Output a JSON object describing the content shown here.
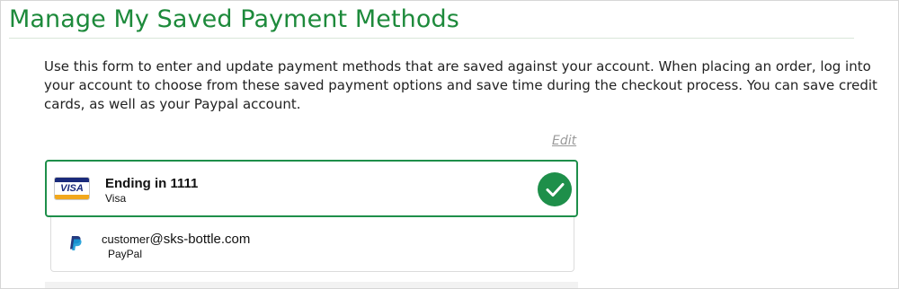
{
  "page": {
    "title": "Manage My Saved Payment Methods",
    "intro": "Use this form to enter and update payment methods that are saved against your account. When placing an order, log into your account to choose from these saved payment options and save time during the checkout process. You can save credit cards, as well as your Paypal account.",
    "edit_label": "Edit"
  },
  "payment_methods": [
    {
      "icon": "visa-card-icon",
      "logo_text": "VISA",
      "title": "Ending in 1111",
      "subtitle": "Visa",
      "selected": true
    },
    {
      "icon": "paypal-icon",
      "title_user": "customer",
      "title_domain": "@sks-bottle.com",
      "subtitle": "PayPal",
      "selected": false
    }
  ],
  "colors": {
    "title": "#1d8a3b",
    "selected_border": "#1e8f4a",
    "check_badge": "#1e8f4a"
  }
}
